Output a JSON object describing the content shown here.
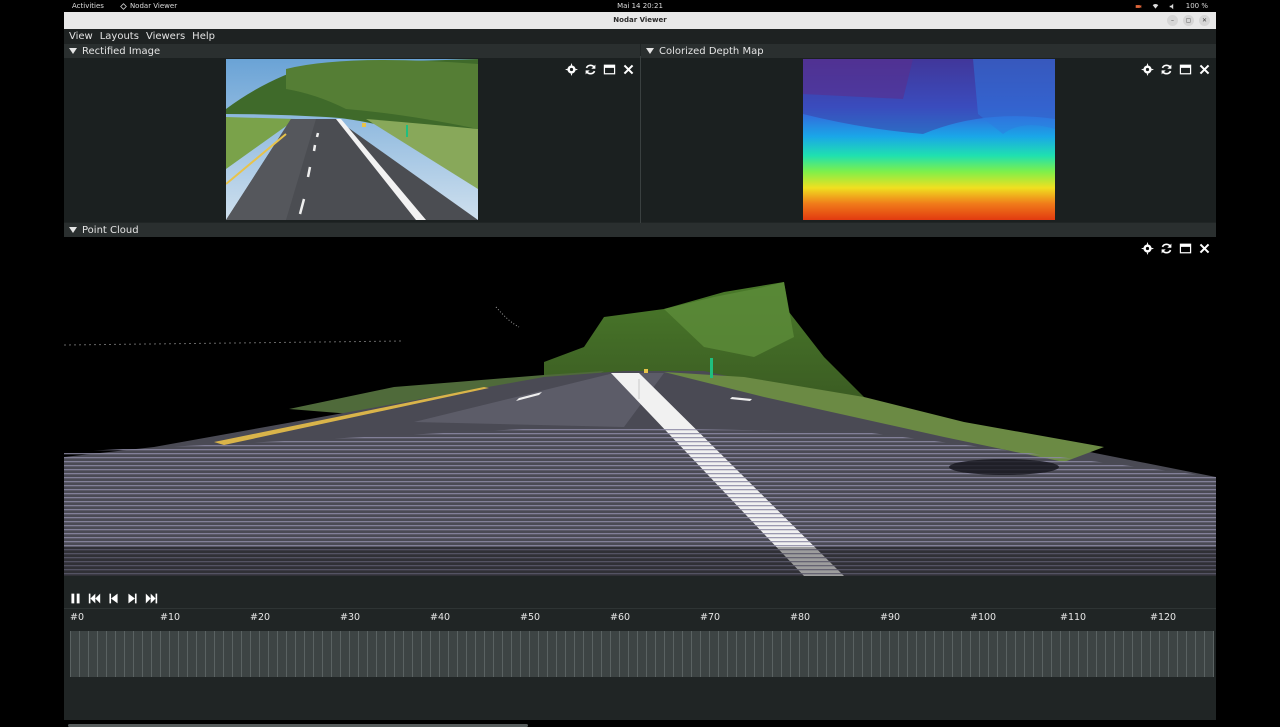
{
  "topbar": {
    "activities": "Activities",
    "app_name": "Nodar Viewer",
    "clock": "Mai 14  20:21",
    "battery": "100 %"
  },
  "window": {
    "title": "Nodar Viewer"
  },
  "menu": [
    "View",
    "Layouts",
    "Viewers",
    "Help"
  ],
  "panels": {
    "rectified": {
      "title": "Rectified Image"
    },
    "depth": {
      "title": "Colorized Depth Map"
    },
    "pointcloud": {
      "title": "Point Cloud"
    }
  },
  "icons": {
    "tools": [
      "gear-icon",
      "refresh-icon",
      "maximize-icon",
      "close-icon"
    ],
    "playback": [
      "pause-icon",
      "skip-to-start-icon",
      "step-back-icon",
      "step-forward-icon",
      "skip-to-end-icon"
    ]
  },
  "timeline": {
    "ticks": [
      "#0",
      "#10",
      "#20",
      "#30",
      "#40",
      "#50",
      "#60",
      "#70",
      "#80",
      "#90",
      "#100",
      "#110",
      "#120"
    ]
  },
  "colors": {
    "background": "#202525",
    "panel_header": "#2a2f2f",
    "timeline": "#3d4444"
  }
}
